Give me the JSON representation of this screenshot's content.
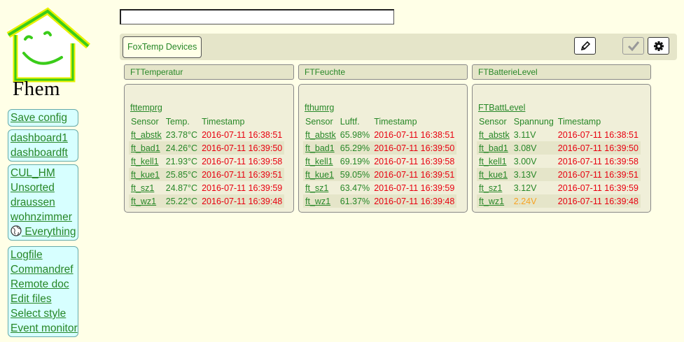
{
  "logo": {
    "text": "Fhem"
  },
  "command": {
    "value": ""
  },
  "menu": {
    "block1": [
      "Save config"
    ],
    "block2": [
      "dashboard1",
      "dashboardft"
    ],
    "block3": [
      "CUL_HM",
      "Unsorted",
      "draussen",
      "wohnzimmer",
      "Everything"
    ],
    "block4": [
      "Logfile",
      "Commandref",
      "Remote doc",
      "Edit files",
      "Select style",
      "Event monitor"
    ]
  },
  "room": {
    "name": "FoxTemp Devices"
  },
  "colors": {
    "background": "#FFFFE7",
    "link": "#278727",
    "timestamp": "#E8000F",
    "warning": "#F7A323",
    "menu_bg": "#D7FFFF"
  },
  "panels": [
    {
      "title": "FTTemperatur",
      "link": "fttemprg",
      "headers": [
        "Sensor",
        "Temp.",
        "Timestamp"
      ],
      "rows": [
        [
          "ft_abstk",
          "23.78°C",
          "2016-07-11 16:38:51"
        ],
        [
          "ft_bad1",
          "24.26°C",
          "2016-07-11 16:39:50"
        ],
        [
          "ft_kell1",
          "21.93°C",
          "2016-07-11 16:39:58"
        ],
        [
          "ft_kue1",
          "25.85°C",
          "2016-07-11 16:39:51"
        ],
        [
          "ft_sz1",
          "24.87°C",
          "2016-07-11 16:39:59"
        ],
        [
          "ft_wz1",
          "25.22°C",
          "2016-07-11 16:39:48"
        ]
      ]
    },
    {
      "title": "FTFeuchte",
      "link": "fthumrg",
      "headers": [
        "Sensor",
        "Luftf.",
        "Timestamp"
      ],
      "rows": [
        [
          "ft_abstk",
          "65.98%",
          "2016-07-11 16:38:51"
        ],
        [
          "ft_bad1",
          "65.29%",
          "2016-07-11 16:39:50"
        ],
        [
          "ft_kell1",
          "69.19%",
          "2016-07-11 16:39:58"
        ],
        [
          "ft_kue1",
          "59.05%",
          "2016-07-11 16:39:51"
        ],
        [
          "ft_sz1",
          "63.47%",
          "2016-07-11 16:39:59"
        ],
        [
          "ft_wz1",
          "61.37%",
          "2016-07-11 16:39:48"
        ]
      ]
    },
    {
      "title": "FTBatterieLevel",
      "link": "FTBattLevel",
      "headers": [
        "Sensor",
        "Spannung",
        "Timestamp"
      ],
      "rows": [
        [
          "ft_abstk",
          "3.11V",
          "2016-07-11 16:38:51"
        ],
        [
          "ft_bad1",
          "3.08V",
          "2016-07-11 16:39:50"
        ],
        [
          "ft_kell1",
          "3.00V",
          "2016-07-11 16:39:58"
        ],
        [
          "ft_kue1",
          "3.13V",
          "2016-07-11 16:39:51"
        ],
        [
          "ft_sz1",
          "3.12V",
          "2016-07-11 16:39:59"
        ],
        [
          "ft_wz1",
          "2.24V",
          "2016-07-11 16:39:48"
        ]
      ],
      "warning_row": 5
    }
  ]
}
